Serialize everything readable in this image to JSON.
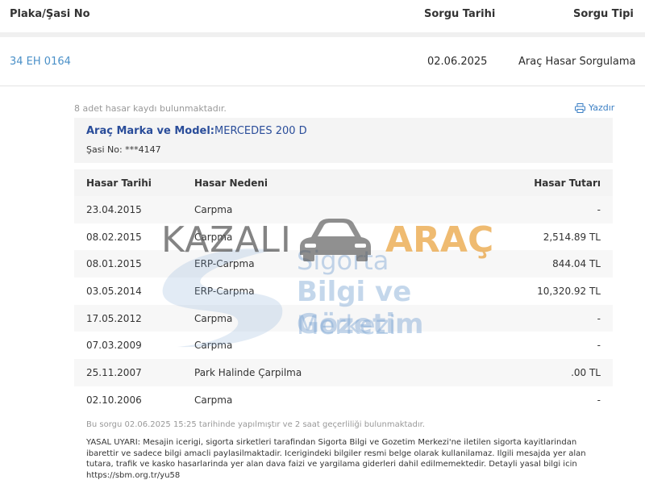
{
  "header": {
    "col_plate": "Plaka/Şasi No",
    "col_date": "Sorgu Tarihi",
    "col_type": "Sorgu Tipi"
  },
  "query": {
    "plate": "34 EH 0164",
    "date": "02.06.2025",
    "type": "Araç Hasar Sorgulama"
  },
  "summary": {
    "count_text": "8 adet hasar kaydı bulunmaktadır.",
    "print_label": "Yazdır"
  },
  "vehicle": {
    "model_label": "Araç Marka ve Model:",
    "model_value": "MERCEDES 200 D",
    "chassis_label": "Şasi No:",
    "chassis_value": "***4147"
  },
  "table": {
    "headers": [
      "Hasar Tarihi",
      "Hasar Nedeni",
      "Hasar Tutarı"
    ],
    "rows": [
      {
        "date": "23.04.2015",
        "reason": "Carpma",
        "amount": "-"
      },
      {
        "date": "08.02.2015",
        "reason": "Carpma",
        "amount": "2,514.89 TL"
      },
      {
        "date": "08.01.2015",
        "reason": "ERP-Carpma",
        "amount": "844.04 TL"
      },
      {
        "date": "03.05.2014",
        "reason": "ERP-Carpma",
        "amount": "10,320.92 TL"
      },
      {
        "date": "17.05.2012",
        "reason": "Carpma",
        "amount": "-"
      },
      {
        "date": "07.03.2009",
        "reason": "Carpma",
        "amount": "-"
      },
      {
        "date": "25.11.2007",
        "reason": "Park Halinde Çarpilma",
        "amount": ".00 TL"
      },
      {
        "date": "02.10.2006",
        "reason": "Carpma",
        "amount": "-"
      }
    ]
  },
  "footer": {
    "validity": "Bu sorgu 02.06.2025 15:25 tarihinde yapılmıştır ve 2 saat geçerliliği bulunmaktadır.",
    "legal": "YASAL UYARI: Mesajin icerigi, sigorta sirketleri tarafindan Sigorta Bilgi ve Gozetim Merkezi'ne iletilen sigorta kayitlarindan ibarettir ve sadece bilgi amacli paylasilmaktadir. Icerigindeki bilgiler resmi belge olarak kullanilamaz. Ilgili mesajda yer alan tutara, trafik ve kasko hasarlarinda yer alan dava faizi ve yargilama giderleri dahil edilmemektedir. Detayli yasal bilgi icin https://sbm.org.tr/yu58"
  },
  "watermark": {
    "brand_left": "KAZALI",
    "brand_right": "ARAÇ",
    "logo_line1": "Sigorta",
    "logo_line2": "Bilgi ve Gözetim",
    "logo_line3": "Merkezi"
  },
  "colors": {
    "link": "#4a90c8",
    "model_text": "#2a4d9a",
    "brand_orange": "#e9a13b"
  }
}
